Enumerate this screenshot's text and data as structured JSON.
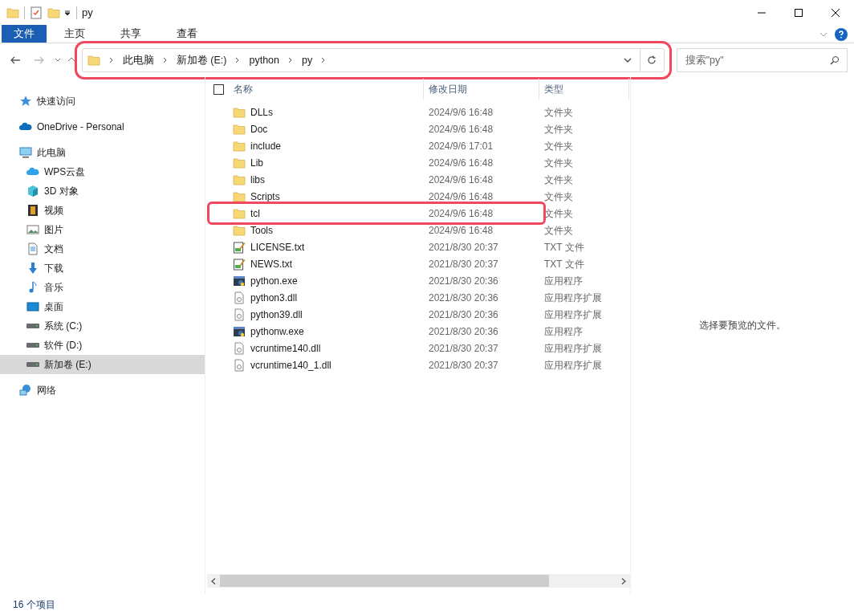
{
  "window": {
    "title": "py"
  },
  "ribbon_tabs": [
    {
      "label": "文件",
      "selected": true
    },
    {
      "label": "主页",
      "selected": false
    },
    {
      "label": "共享",
      "selected": false
    },
    {
      "label": "查看",
      "selected": false
    }
  ],
  "address_bar": {
    "highlighted": true,
    "crumbs": [
      "此电脑",
      "新加卷 (E:)",
      "python",
      "py"
    ]
  },
  "search": {
    "placeholder": "搜索\"py\""
  },
  "sidebar": {
    "items": [
      {
        "label": "快速访问",
        "kind": "star",
        "selected": false
      },
      {
        "label": "OneDrive - Personal",
        "kind": "cloud",
        "selected": false
      },
      {
        "label": "此电脑",
        "kind": "pc",
        "selected": false,
        "children": [
          {
            "label": "WPS云盘",
            "kind": "cloud2",
            "selected": false
          },
          {
            "label": "3D 对象",
            "kind": "cube",
            "selected": false
          },
          {
            "label": "视频",
            "kind": "video",
            "selected": false
          },
          {
            "label": "图片",
            "kind": "image",
            "selected": false
          },
          {
            "label": "文档",
            "kind": "doc",
            "selected": false
          },
          {
            "label": "下载",
            "kind": "download",
            "selected": false
          },
          {
            "label": "音乐",
            "kind": "music",
            "selected": false
          },
          {
            "label": "桌面",
            "kind": "desktop",
            "selected": false
          },
          {
            "label": "系统 (C:)",
            "kind": "drive",
            "selected": false
          },
          {
            "label": "软件 (D:)",
            "kind": "drive",
            "selected": false
          },
          {
            "label": "新加卷 (E:)",
            "kind": "drive",
            "selected": true
          }
        ]
      },
      {
        "label": "网络",
        "kind": "network",
        "selected": false
      }
    ]
  },
  "table": {
    "select_all": {
      "checked": false
    },
    "columns": [
      "名称",
      "修改日期",
      "类型"
    ],
    "rows": [
      {
        "name": "DLLs",
        "date": "2024/9/6 16:48",
        "type": "文件夹",
        "kind": "folder",
        "highlighted": false
      },
      {
        "name": "Doc",
        "date": "2024/9/6 16:48",
        "type": "文件夹",
        "kind": "folder",
        "highlighted": false
      },
      {
        "name": "include",
        "date": "2024/9/6 17:01",
        "type": "文件夹",
        "kind": "folder",
        "highlighted": false
      },
      {
        "name": "Lib",
        "date": "2024/9/6 16:48",
        "type": "文件夹",
        "kind": "folder",
        "highlighted": false
      },
      {
        "name": "libs",
        "date": "2024/9/6 16:48",
        "type": "文件夹",
        "kind": "folder",
        "highlighted": false
      },
      {
        "name": "Scripts",
        "date": "2024/9/6 16:48",
        "type": "文件夹",
        "kind": "folder",
        "highlighted": false
      },
      {
        "name": "tcl",
        "date": "2024/9/6 16:48",
        "type": "文件夹",
        "kind": "folder",
        "highlighted": true
      },
      {
        "name": "Tools",
        "date": "2024/9/6 16:48",
        "type": "文件夹",
        "kind": "folder",
        "highlighted": false
      },
      {
        "name": "LICENSE.txt",
        "date": "2021/8/30 20:37",
        "type": "TXT 文件",
        "kind": "text",
        "highlighted": false
      },
      {
        "name": "NEWS.txt",
        "date": "2021/8/30 20:37",
        "type": "TXT 文件",
        "kind": "text",
        "highlighted": false
      },
      {
        "name": "python.exe",
        "date": "2021/8/30 20:36",
        "type": "应用程序",
        "kind": "exe",
        "highlighted": false
      },
      {
        "name": "python3.dll",
        "date": "2021/8/30 20:36",
        "type": "应用程序扩展",
        "kind": "dll",
        "highlighted": false
      },
      {
        "name": "python39.dll",
        "date": "2021/8/30 20:36",
        "type": "应用程序扩展",
        "kind": "dll",
        "highlighted": false
      },
      {
        "name": "pythonw.exe",
        "date": "2021/8/30 20:36",
        "type": "应用程序",
        "kind": "exe",
        "highlighted": false
      },
      {
        "name": "vcruntime140.dll",
        "date": "2021/8/30 20:37",
        "type": "应用程序扩展",
        "kind": "dll",
        "highlighted": false
      },
      {
        "name": "vcruntime140_1.dll",
        "date": "2021/8/30 20:37",
        "type": "应用程序扩展",
        "kind": "dll",
        "highlighted": false
      }
    ]
  },
  "preview": {
    "message": "选择要预览的文件。"
  },
  "status_bar": {
    "count": "16 个项目"
  }
}
